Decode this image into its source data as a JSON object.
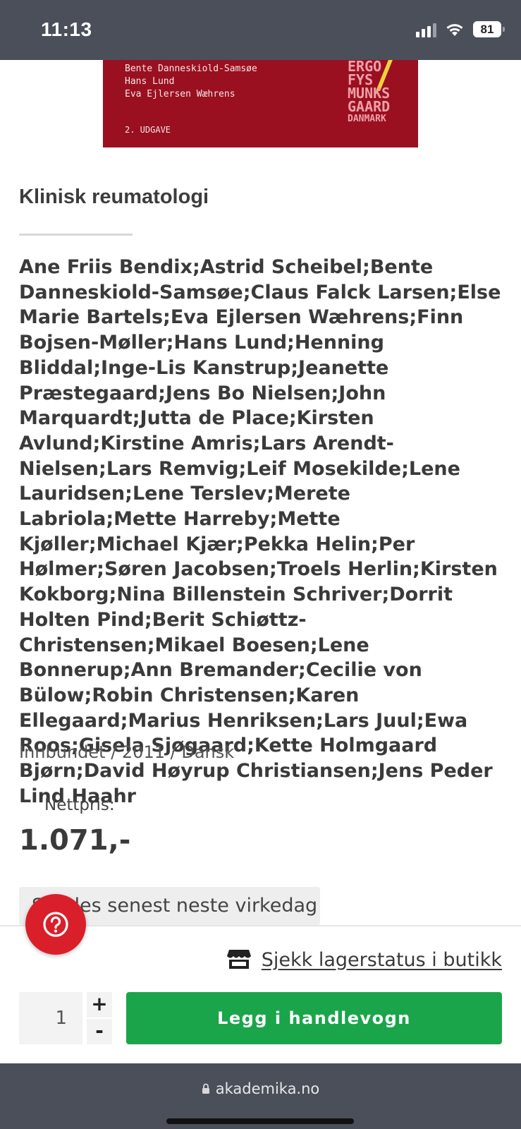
{
  "status_bar": {
    "time": "11:13",
    "battery": "81"
  },
  "cover": {
    "authors": [
      "Bente Danneskiold-Samsøe",
      "Hans Lund",
      "Eva Ejlersen Wæhrens"
    ],
    "edition": "2. UDGAVE",
    "logo_lines": [
      "ERGO",
      "FYS",
      "MUNKS",
      "GAARD",
      "DANMARK"
    ],
    "colors": {
      "background": "#9a1020",
      "accent": "#f0d23a"
    }
  },
  "product": {
    "title": "Klinisk reumatologi",
    "authors": "Ane Friis Bendix;Astrid Scheibel;Bente Danneskiold-Samsøe;Claus Falck Larsen;Else Marie Bartels;Eva Ejlersen Wæhrens;Finn Bojsen-Møller;Hans Lund;Henning Bliddal;Inge-Lis Kanstrup;Jeanette Præstegaard;Jens Bo Nielsen;John Marquardt;Jutta de Place;Kirsten Avlund;Kirstine Amris;Lars Arendt-Nielsen;Lars Remvig;Leif Mosekilde;Lene Lauridsen;Lene Terslev;Merete Labriola;Mette Harreby;Mette Kjøller;Michael Kjær;Pekka Helin;Per Hølmer;Søren Jacobsen;Troels Herlin;Kirsten Kokborg;Nina Billenstein Schriver;Dorrit Holten Pind;Berit Schiøttz-Christensen;Mikael Boesen;Lene Bonnerup;Ann Bremander;Cecilie von Bülow;Robin Christensen;Karen Ellegaard;Marius Henriksen;Lars Juul;Ewa Roos;Gisela Sjøgaard;Kette Holmgaard Bjørn;David Høyrup Christiansen;Jens Peder Lind Haahr",
    "meta": "Innbundet / 2011 / Dansk",
    "price_label": "Nettpris:",
    "price": "1.071,-",
    "delivery": "Sendes senest neste virkedag"
  },
  "actions": {
    "stock_link": "Sjekk lagerstatus i butikk",
    "quantity": "1",
    "plus": "+",
    "minus": "-",
    "add_to_cart": "Legg i handlevogn",
    "colors": {
      "primary": "#1aa54a",
      "help": "#d91f2a"
    }
  },
  "browser": {
    "url": "akademika.no"
  },
  "icons": {
    "help": "question-circle-icon",
    "store": "store-icon",
    "lock": "lock-icon"
  }
}
